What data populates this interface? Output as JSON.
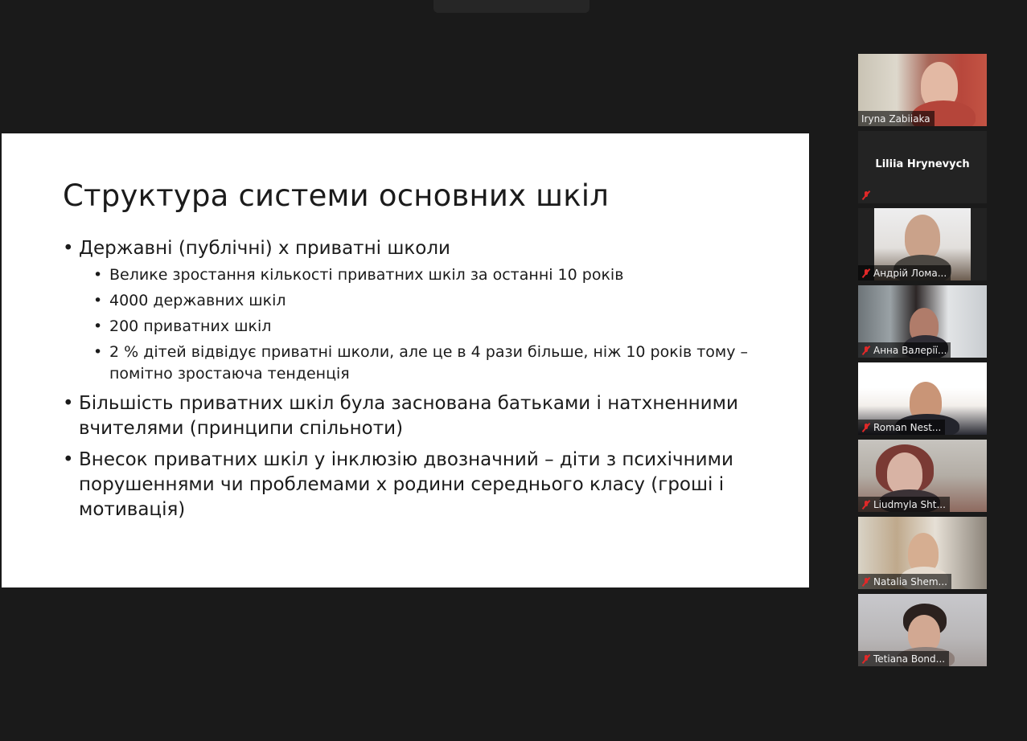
{
  "slide": {
    "title": "Структура системи основних шкіл",
    "bullets": [
      {
        "text": "Державні (публічні) х приватні школи",
        "sub": [
          "Велике зростання кількості приватних шкіл за останні 10 років",
          "4000 державних шкіл",
          "200 приватних шкіл",
          "2 % дітей відвідує приватні школи, але це в 4 рази більше, ніж 10 років тому – помітно зростаюча тенденція"
        ]
      },
      {
        "text": "Більшість приватних шкіл була заснована батьками і натхненними вчителями (принципи спільноти)",
        "sub": []
      },
      {
        "text": "Внесок приватних шкіл у інклюзію двозначний – діти з психічними порушеннями чи проблемами х родини середнього класу (гроші і мотивація)",
        "sub": []
      }
    ]
  },
  "participants": [
    {
      "name": "Iryna Zabiiaka",
      "muted": false,
      "video": true
    },
    {
      "name": "Liliia Hrynevych",
      "muted": true,
      "video": false
    },
    {
      "name": "Андрій Лома...",
      "muted": true,
      "video": true
    },
    {
      "name": "Анна Валерії...",
      "muted": true,
      "video": true
    },
    {
      "name": "Roman Nest...",
      "muted": true,
      "video": true
    },
    {
      "name": "Liudmyla Sht...",
      "muted": true,
      "video": true
    },
    {
      "name": "Natalia Shem...",
      "muted": true,
      "video": true
    },
    {
      "name": "Tetiana Bond...",
      "muted": true,
      "video": true
    }
  ],
  "colors": {
    "background": "#1a1a1a",
    "slide_background": "#ffffff",
    "mute_icon": "#e02828"
  },
  "icons": [
    "microphone-muted-icon"
  ]
}
